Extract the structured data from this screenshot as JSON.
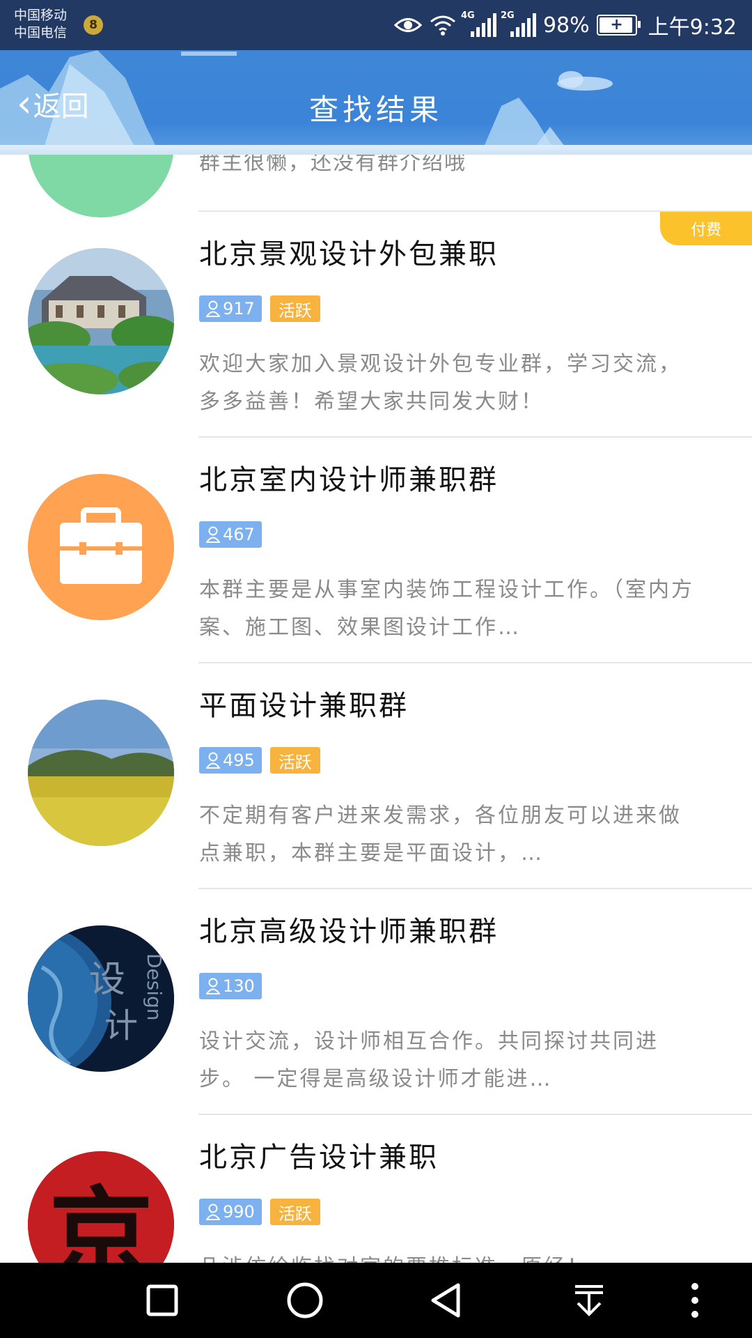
{
  "status_bar": {
    "carrier_1": "中国移动",
    "carrier_2": "中国电信",
    "notification_count": "8",
    "network_1": "4G",
    "network_2": "2G",
    "battery": "98%",
    "time": "上午9:32"
  },
  "header": {
    "back_label": "返回",
    "title": "查找结果"
  },
  "partial_item": {
    "desc": "群主很懒，还没有群介绍哦"
  },
  "items": [
    {
      "name": "北京景观设计外包兼职",
      "members": "917",
      "active_label": "活跃",
      "paid_label": "付费",
      "desc": "欢迎大家加入景观设计外包专业群，学习交流，多多益善！希望大家共同发大财！"
    },
    {
      "name": "北京室内设计师兼职群",
      "members": "467",
      "desc": "本群主要是从事室内装饰工程设计工作。（室内方案、施工图、效果图设计工作…"
    },
    {
      "name": "平面设计兼职群",
      "members": "495",
      "active_label": "活跃",
      "desc": "不定期有客户进来发需求，各位朋友可以进来做点兼职，本群主要是平面设计，…"
    },
    {
      "name": "北京高级设计师兼职群",
      "members": "130",
      "avatar_text_1": "设",
      "avatar_text_2": "计",
      "avatar_text_3": "Design",
      "desc": "设计交流，设计师相互合作。共同探讨共同进步。 一定得是高级设计师才能进…"
    },
    {
      "name": "北京广告设计兼职",
      "members": "990",
      "active_label": "活跃",
      "avatar_text": "京",
      "desc": "凡涉仿绘临找对宣的要推标准，原经！"
    }
  ],
  "colors": {
    "header_blue": "#3b84d8",
    "badge_blue": "#7db0ee",
    "badge_orange": "#f7b33d",
    "paid_yellow": "#fcc22c",
    "briefcase_orange": "#ffa352"
  }
}
